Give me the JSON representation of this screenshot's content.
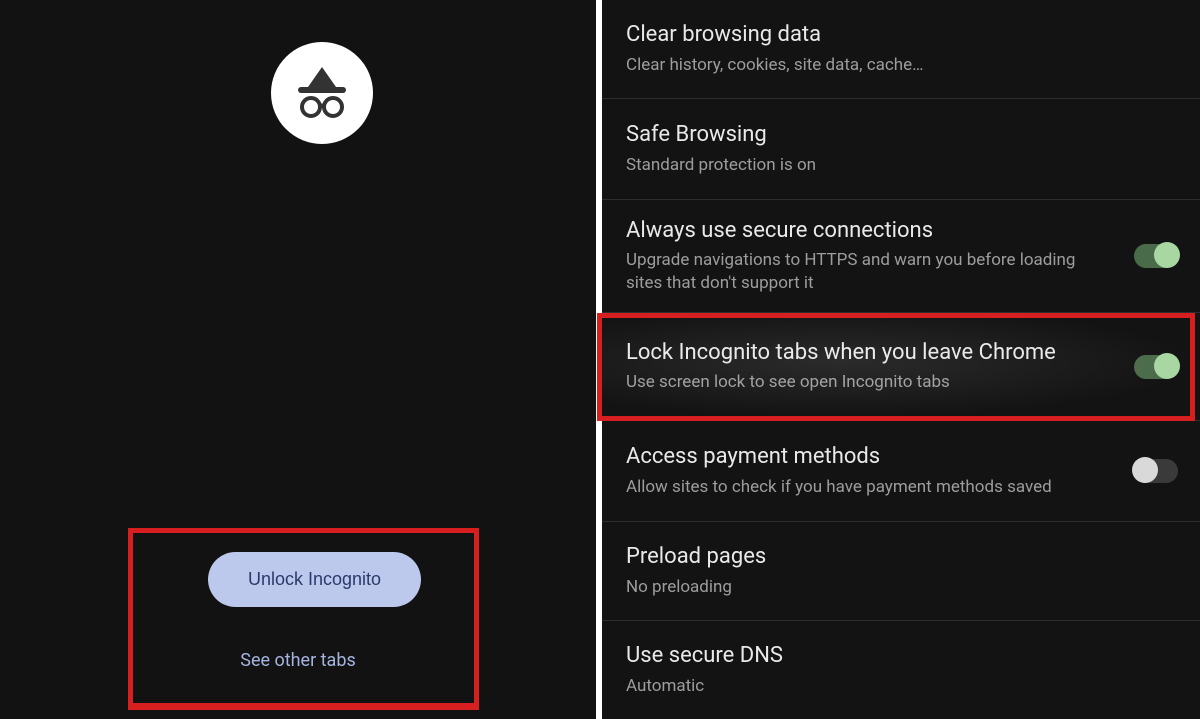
{
  "left": {
    "unlock_button": "Unlock Incognito",
    "see_other_tabs": "See other tabs"
  },
  "settings": [
    {
      "title": "Clear browsing data",
      "subtitle": "Clear history, cookies, site data, cache…",
      "toggle": null
    },
    {
      "title": "Safe Browsing",
      "subtitle": "Standard protection is on",
      "toggle": null
    },
    {
      "title": "Always use secure connections",
      "subtitle": "Upgrade navigations to HTTPS and warn you before loading sites that don't support it",
      "toggle": "on"
    },
    {
      "title": "Lock Incognito tabs when you leave Chrome",
      "subtitle": "Use screen lock to see open Incognito tabs",
      "toggle": "on",
      "highlighted": true
    },
    {
      "title": "Access payment methods",
      "subtitle": "Allow sites to check if you have payment methods saved",
      "toggle": "off"
    },
    {
      "title": "Preload pages",
      "subtitle": "No preloading",
      "toggle": null
    },
    {
      "title": "Use secure DNS",
      "subtitle": "Automatic",
      "toggle": null
    }
  ],
  "colors": {
    "highlight": "#d81f1f",
    "toggle_on_thumb": "#a8d7a2",
    "toggle_off_thumb": "#d9d9d9"
  }
}
